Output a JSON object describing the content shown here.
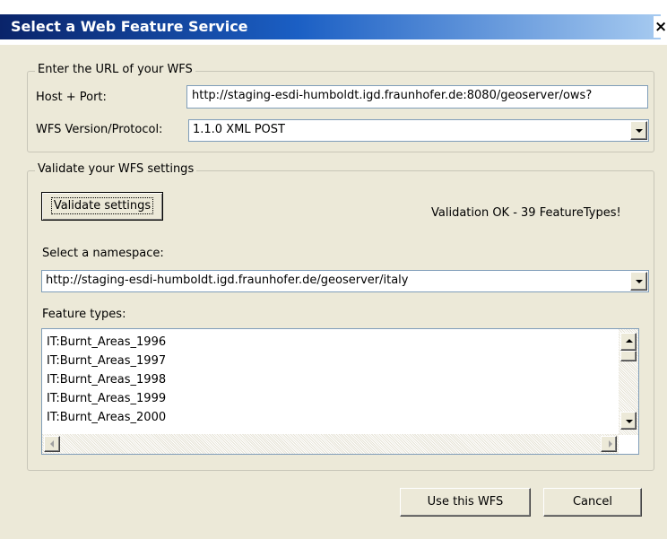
{
  "window": {
    "title": "Select a Web Feature Service",
    "close_label": "×"
  },
  "url_group": {
    "legend": "Enter the URL of your WFS",
    "host_label": "Host + Port:",
    "host_value": "http://staging-esdi-humboldt.igd.fraunhofer.de:8080/geoserver/ows?",
    "version_label": "WFS Version/Protocol:",
    "version_value": "1.1.0 XML POST"
  },
  "validate_group": {
    "legend": "Validate your WFS settings",
    "validate_button": "Validate settings",
    "status": "Validation OK - 39 FeatureTypes!",
    "namespace_label": "Select a namespace:",
    "namespace_value": "http://staging-esdi-humboldt.igd.fraunhofer.de/geoserver/italy",
    "feature_types_label": "Feature types:",
    "feature_types": [
      "IT:Burnt_Areas_1996",
      "IT:Burnt_Areas_1997",
      "IT:Burnt_Areas_1998",
      "IT:Burnt_Areas_1999",
      "IT:Burnt_Areas_2000"
    ]
  },
  "footer": {
    "use_button": "Use this WFS",
    "cancel_button": "Cancel"
  },
  "icons": {
    "dropdown": "chevron-down-icon",
    "scroll_up": "arrow-up-icon",
    "scroll_down": "arrow-down-icon",
    "scroll_left": "arrow-left-icon",
    "scroll_right": "arrow-right-icon",
    "close": "close-icon"
  },
  "colors": {
    "title_start": "#0a246a",
    "title_end": "#a6caf0",
    "dialog_bg": "#ece9d8",
    "field_border": "#7f9db9"
  }
}
